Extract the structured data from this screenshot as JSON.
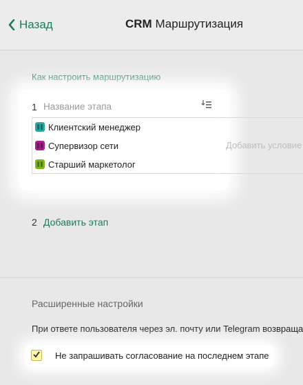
{
  "header": {
    "back_label": "Назад",
    "title_bold": "CRM",
    "title_rest": "Маршрутизация"
  },
  "help_link": "Как настроить маршрутизацию",
  "stage1": {
    "number": "1",
    "name_placeholder": "Название этапа",
    "roles": [
      {
        "label": "Клиентский менеджер",
        "color": "#2aa6a0"
      },
      {
        "label": "Супервизор сети",
        "color": "#a51f8c"
      },
      {
        "label": "Старший маркетолог",
        "color": "#7bb51e"
      }
    ],
    "add_condition": "Добавить условие"
  },
  "stage2": {
    "number": "2",
    "add_label": "Добавить этап"
  },
  "advanced": {
    "title": "Расширенные настройки",
    "reply_text": "При ответе пользователя через эл. почту или Telegram возвращать",
    "checkbox_label": "Не запрашивать согласование на последнем этапе",
    "checkbox_checked": true
  },
  "colors": {
    "accent": "#1e7a57",
    "checkbox_fill": "#fff3a6"
  }
}
